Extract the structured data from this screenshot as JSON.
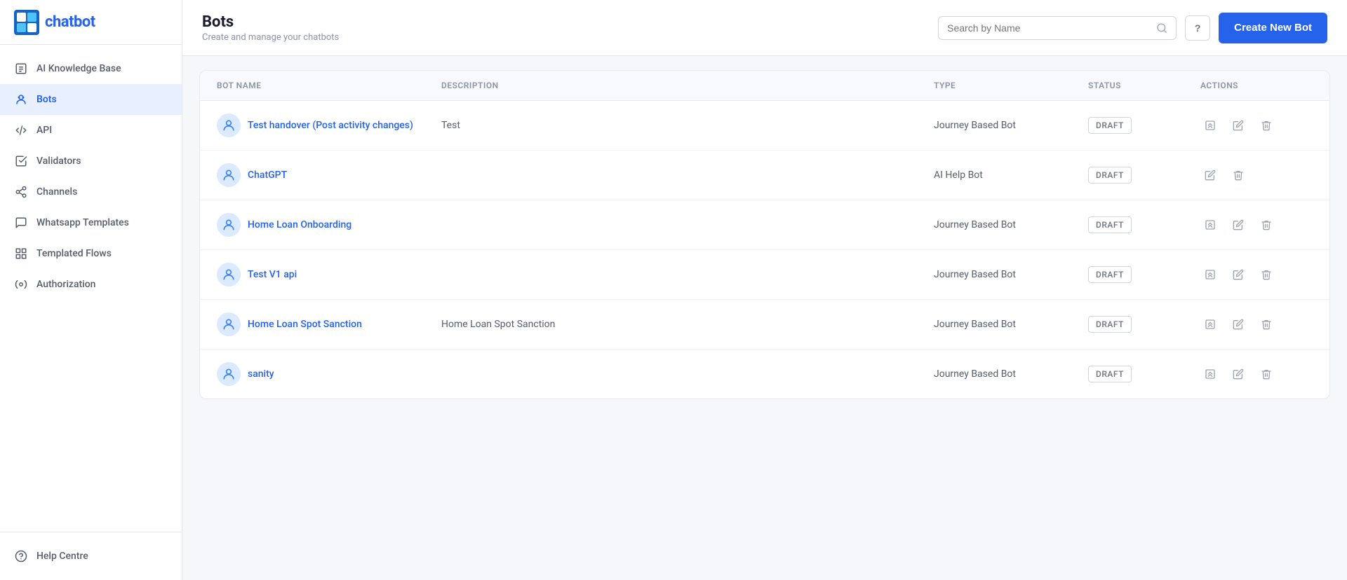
{
  "app": {
    "name": "chatbot",
    "logo_text_part1": "chat",
    "logo_text_part2": "bot"
  },
  "sidebar": {
    "items": [
      {
        "id": "ai-knowledge-base",
        "label": "AI Knowledge Base",
        "icon": "document-icon",
        "active": false
      },
      {
        "id": "bots",
        "label": "Bots",
        "icon": "bot-icon",
        "active": true
      },
      {
        "id": "api",
        "label": "API",
        "icon": "api-icon",
        "active": false
      },
      {
        "id": "validators",
        "label": "Validators",
        "icon": "validators-icon",
        "active": false
      },
      {
        "id": "channels",
        "label": "Channels",
        "icon": "channels-icon",
        "active": false
      },
      {
        "id": "whatsapp-templates",
        "label": "Whatsapp Templates",
        "icon": "whatsapp-icon",
        "active": false
      },
      {
        "id": "templated-flows",
        "label": "Templated Flows",
        "icon": "flows-icon",
        "active": false
      },
      {
        "id": "authorization",
        "label": "Authorization",
        "icon": "auth-icon",
        "active": false
      }
    ],
    "footer_items": [
      {
        "id": "help-centre",
        "label": "Help Centre",
        "icon": "help-icon",
        "active": false
      }
    ]
  },
  "header": {
    "title": "Bots",
    "subtitle": "Create and manage your chatbots",
    "search_placeholder": "Search by Name",
    "help_label": "?",
    "create_button_label": "Create New Bot"
  },
  "table": {
    "columns": [
      {
        "id": "bot-name",
        "label": "Bot Name"
      },
      {
        "id": "description",
        "label": "Description"
      },
      {
        "id": "type",
        "label": "Type"
      },
      {
        "id": "status",
        "label": "Status"
      },
      {
        "id": "actions",
        "label": "Actions"
      }
    ],
    "rows": [
      {
        "id": "bot-1",
        "name": "Test handover (Post activity changes)",
        "description": "Test",
        "type": "Journey Based Bot",
        "status": "DRAFT",
        "has_analytics": true
      },
      {
        "id": "bot-2",
        "name": "ChatGPT",
        "description": "",
        "type": "AI Help Bot",
        "status": "DRAFT",
        "has_analytics": false
      },
      {
        "id": "bot-3",
        "name": "Home Loan Onboarding",
        "description": "",
        "type": "Journey Based Bot",
        "status": "DRAFT",
        "has_analytics": true
      },
      {
        "id": "bot-4",
        "name": "Test V1 api",
        "description": "",
        "type": "Journey Based Bot",
        "status": "DRAFT",
        "has_analytics": true
      },
      {
        "id": "bot-5",
        "name": "Home Loan Spot Sanction",
        "description": "Home Loan Spot Sanction",
        "type": "Journey Based Bot",
        "status": "DRAFT",
        "has_analytics": true
      },
      {
        "id": "bot-6",
        "name": "sanity",
        "description": "",
        "type": "Journey Based Bot",
        "status": "DRAFT",
        "has_analytics": true
      }
    ]
  }
}
